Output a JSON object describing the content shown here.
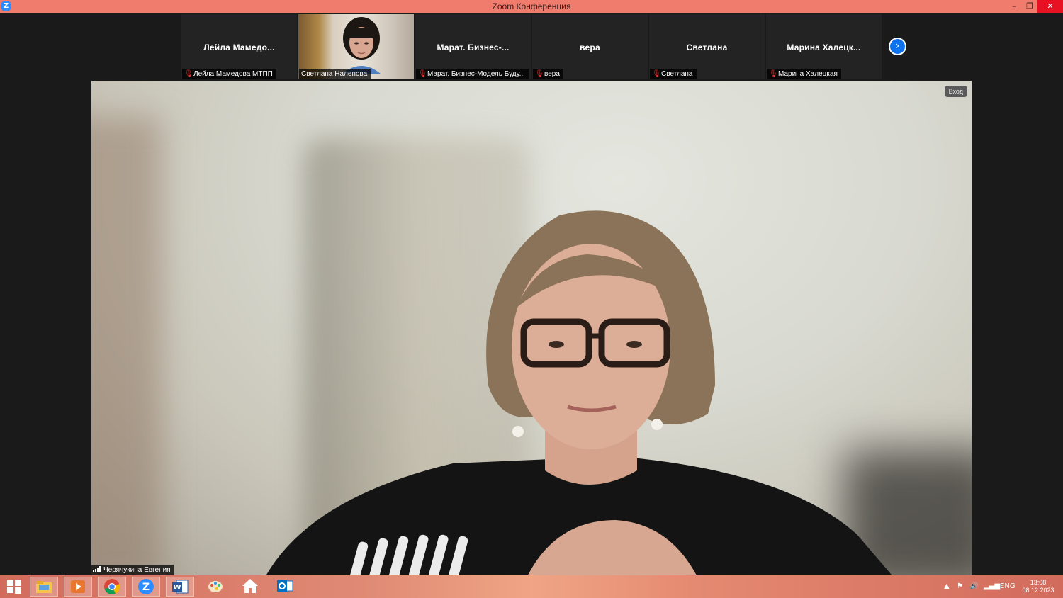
{
  "window": {
    "title": "Zoom Конференция",
    "minimize": "–",
    "restore": "❐",
    "close": "✕"
  },
  "thumbnails": [
    {
      "display_name": "Лейла  Мамедо...",
      "caption": "Лейла Мамедова МТПП",
      "muted": true
    },
    {
      "display_name": "",
      "caption": "Светлана Налепова",
      "muted": false,
      "video": true
    },
    {
      "display_name": "Марат.  Бизнес-...",
      "caption": "Марат. Бизнес-Модель Буду...",
      "muted": true
    },
    {
      "display_name": "вера",
      "caption": "вера",
      "muted": true
    },
    {
      "display_name": "Светлана",
      "caption": "Светлана",
      "muted": true
    },
    {
      "display_name": "Марина  Халецк...",
      "caption": "Марина Халецкая",
      "muted": true
    }
  ],
  "next_page_icon": "chevron-right-icon",
  "main_speaker": {
    "name": "Черячукина Евгения",
    "badge": "Вход"
  },
  "taskbar": {
    "apps": [
      "windows-start-icon",
      "file-explorer-icon",
      "media-player-icon",
      "chrome-icon",
      "zoom-icon",
      "word-icon",
      "paint-icon",
      "home-icon",
      "outlook-icon"
    ],
    "language": "ENG",
    "time": "13:08",
    "date": "08.12.2023"
  },
  "colors": {
    "accent": "#0e72ed",
    "titlebar": "#f07c6e",
    "muted_mic": "#e5322d"
  }
}
